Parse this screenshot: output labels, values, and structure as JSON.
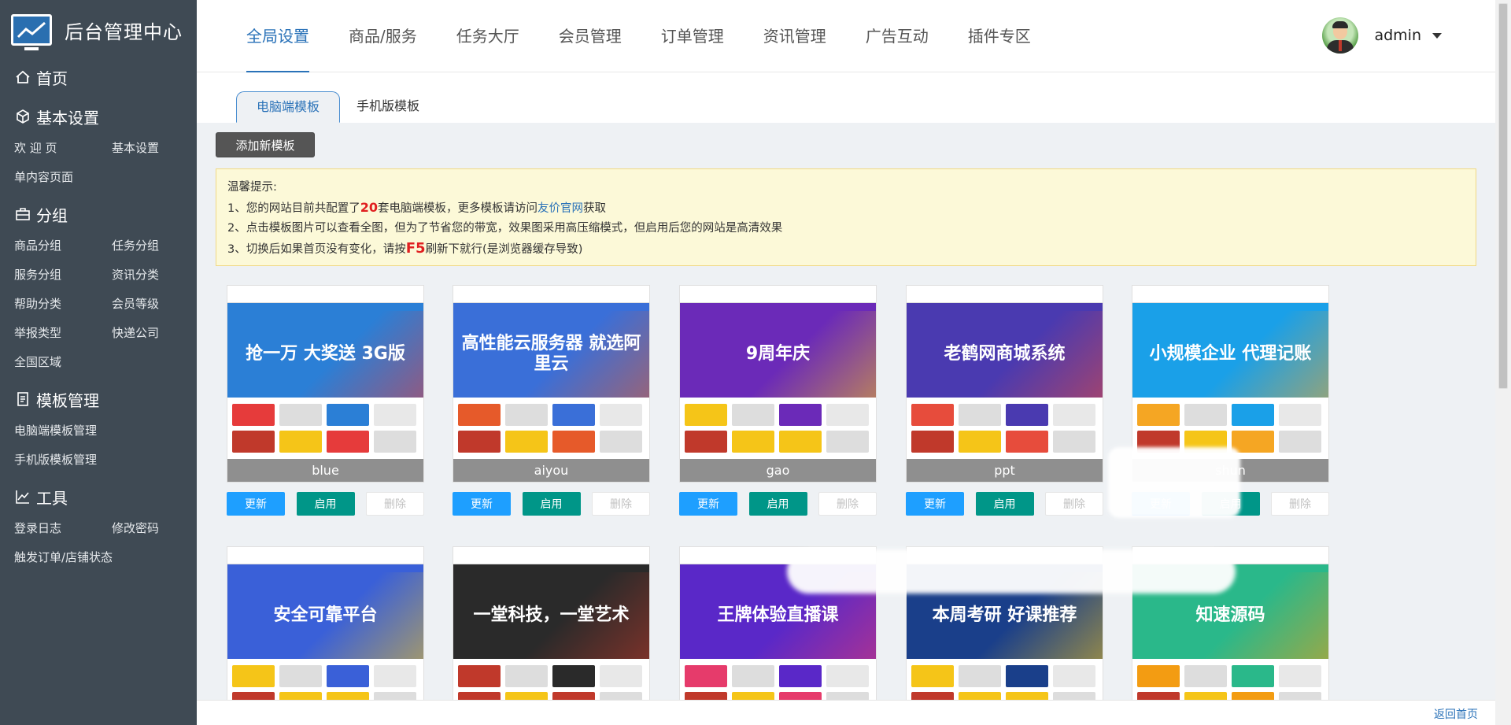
{
  "brand": {
    "title": "后台管理中心"
  },
  "sidebar": {
    "home": "首页",
    "sections": [
      {
        "title": "基本设置",
        "icon": "cube-icon",
        "items": [
          "欢 迎 页",
          "基本设置",
          "单内容页面"
        ]
      },
      {
        "title": "分组",
        "icon": "briefcase-icon",
        "items": [
          "商品分组",
          "任务分组",
          "服务分组",
          "资讯分类",
          "帮助分类",
          "会员等级",
          "举报类型",
          "快递公司",
          "全国区域"
        ]
      },
      {
        "title": "模板管理",
        "icon": "document-icon",
        "items": [
          "电脑端模板管理",
          "手机版模板管理"
        ]
      },
      {
        "title": "工具",
        "icon": "chart-icon",
        "items": [
          "登录日志",
          "修改密码",
          "触发订单/店铺状态"
        ]
      }
    ]
  },
  "topnav": {
    "tabs": [
      "全局设置",
      "商品/服务",
      "任务大厅",
      "会员管理",
      "订单管理",
      "资讯管理",
      "广告互动",
      "插件专区"
    ],
    "active": "全局设置",
    "user": "admin"
  },
  "subtabs": {
    "pc": "电脑端模板",
    "mobile": "手机版模板"
  },
  "add_button": "添加新模板",
  "tip": {
    "title": "温馨提示:",
    "line1_prefix": "1、您的网站目前共配置了",
    "count": "20",
    "line1_mid": "套电脑端模板，更多模板请访问",
    "link": "友价官网",
    "line1_suffix": "获取",
    "line2": "2、点击模板图片可以查看全图，但为了节省您的带宽，效果图采用高压缩模式，但启用后您的网站是高清效果",
    "line3_prefix": "3、切换后如果首页没有变化，请按",
    "f5": "F5",
    "line3_suffix": "刷新下就行(是浏览器缓存导致)"
  },
  "templates_row1": [
    {
      "name": "blue",
      "banner_text": "抢一万 大奖送 3G版",
      "color": "#2b7fd6",
      "accent": "#e63b3b"
    },
    {
      "name": "aiyou",
      "banner_text": "高性能云服务器 就选阿里云",
      "color": "#3a6fd8",
      "accent": "#e65a2a"
    },
    {
      "name": "gao",
      "banner_text": "9周年庆",
      "color": "#6b2ab8",
      "accent": "#f5c518"
    },
    {
      "name": "ppt",
      "banner_text": "老鹤网商城系统",
      "color": "#4a3ab0",
      "accent": "#e74c3c"
    },
    {
      "name": "shun",
      "banner_text": "小规模企业 代理记账",
      "color": "#1aa0e8",
      "accent": "#f5a623"
    }
  ],
  "templates_row2": [
    {
      "name": "",
      "banner_text": "安全可靠平台",
      "color": "#3a60d8",
      "accent": "#f5c518"
    },
    {
      "name": "",
      "banner_text": "一堂科技，一堂艺术",
      "color": "#2a2a2a",
      "accent": "#c0392b"
    },
    {
      "name": "",
      "banner_text": "王牌体验直播课",
      "color": "#5a28c8",
      "accent": "#e63b6b"
    },
    {
      "name": "",
      "banner_text": "本周考研 好课推荐",
      "color": "#1a3f8a",
      "accent": "#f5c518"
    },
    {
      "name": "",
      "banner_text": "知速源码",
      "color": "#2ab88a",
      "accent": "#f39c12"
    }
  ],
  "buttons": {
    "update": "更新",
    "enable": "启用",
    "delete": "删除"
  },
  "footer": {
    "back_home": "返回首页"
  }
}
